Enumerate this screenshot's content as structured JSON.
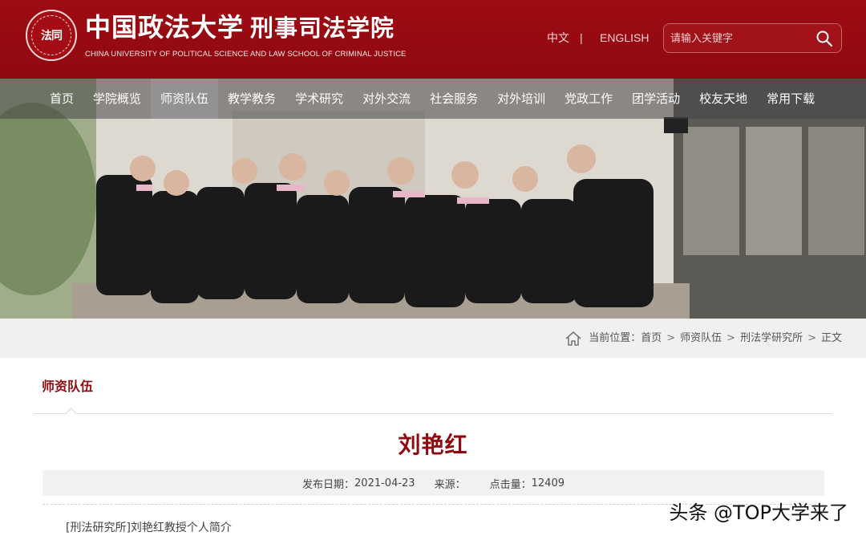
{
  "header": {
    "logo_seal_text": "法同",
    "name_cn": "中国政法大学",
    "school_cn": "刑事司法学院",
    "name_en": "CHINA UNIVERSITY OF POLITICAL SCIENCE AND LAW  SCHOOL OF CRIMINAL JUSTICE",
    "lang_cn": "中文",
    "lang_sep": "|",
    "lang_en": "ENGLISH",
    "search_placeholder": "请输入关键字"
  },
  "nav": {
    "items": [
      "首页",
      "学院概览",
      "师资队伍",
      "教学教务",
      "学术研究",
      "对外交流",
      "社会服务",
      "对外培训",
      "党政工作",
      "团学活动",
      "校友天地",
      "常用下载"
    ],
    "active": "师资队伍"
  },
  "breadcrumb": {
    "label": "当前位置：",
    "items": [
      "首页",
      "师资队伍",
      "刑法学研究所",
      "正文"
    ],
    "separator": ">"
  },
  "section": {
    "title": "师资队伍"
  },
  "article": {
    "title": "刘艳红",
    "publish_label": "发布日期：",
    "publish_date": "2021-04-23",
    "source_label": "来源：",
    "source_value": "",
    "views_label": "点击量：",
    "views": "12409",
    "intro": "[刑法研究所]刘艳红教授个人简介"
  },
  "watermark": "头条 @TOP大学来了",
  "colors": {
    "brand_red": "#9e0b12",
    "title_red": "#8e0a10",
    "nav_overlay": "rgba(70,70,70,0.55)",
    "crumb_bg": "#f0f0f0"
  }
}
